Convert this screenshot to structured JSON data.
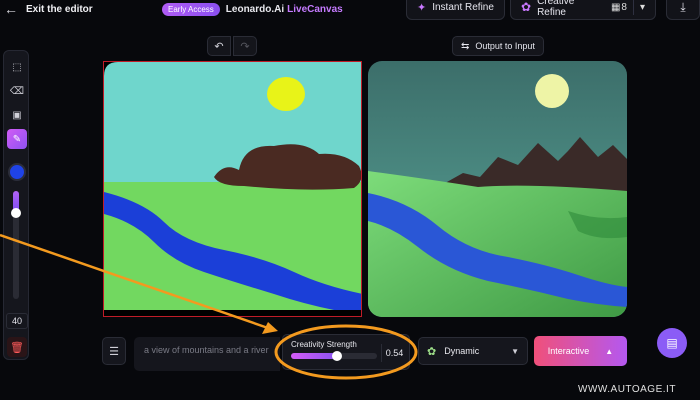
{
  "header": {
    "exit_label": "Exit the editor",
    "badge": "Early Access",
    "brand": "Leonardo.Ai",
    "product": "LiveCanvas",
    "instant_refine": "Instant Refine",
    "creative_refine": "Creative Refine",
    "creative_refine_count": "8"
  },
  "canvas_controls": {
    "output_to_input": "Output to Input"
  },
  "toolbar": {
    "brush_size": "40",
    "brush_level": 0.2,
    "brush_color": "#1f43e6"
  },
  "bottom": {
    "prompt_text": "a view of mountains and a river",
    "strength_label": "Creativity Strength",
    "strength_value": "0.54",
    "style": "Dynamic",
    "mode": "Interactive"
  },
  "watermark": "WWW.AUTOAGE.IT",
  "colors": {
    "accent": "#b458f0",
    "annotation": "#f39a1f"
  }
}
